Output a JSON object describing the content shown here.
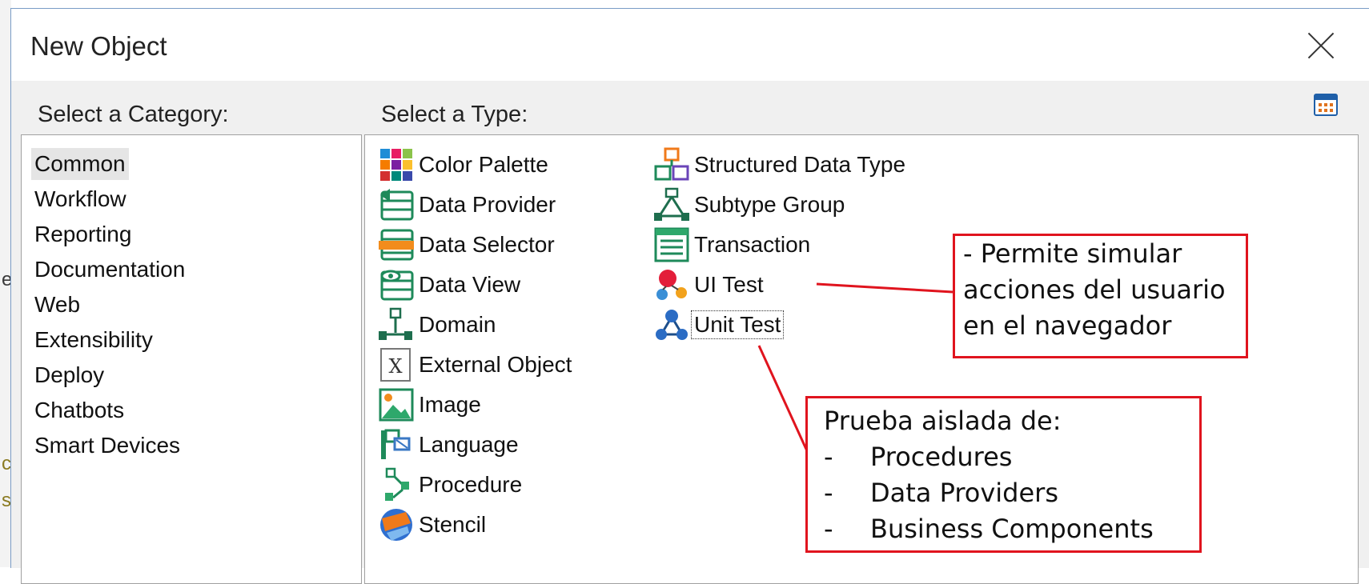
{
  "dialog": {
    "title": "New Object",
    "category_label": "Select a Category:",
    "type_label": "Select a Type:"
  },
  "categories": [
    {
      "label": "Common",
      "selected": true
    },
    {
      "label": "Workflow"
    },
    {
      "label": "Reporting"
    },
    {
      "label": "Documentation"
    },
    {
      "label": "Web"
    },
    {
      "label": "Extensibility"
    },
    {
      "label": "Deploy"
    },
    {
      "label": "Chatbots"
    },
    {
      "label": "Smart Devices"
    }
  ],
  "types_col1": [
    {
      "label": "Color Palette",
      "icon": "color-palette-icon"
    },
    {
      "label": "Data Provider",
      "icon": "data-provider-icon"
    },
    {
      "label": "Data Selector",
      "icon": "data-selector-icon"
    },
    {
      "label": "Data View",
      "icon": "data-view-icon"
    },
    {
      "label": "Domain",
      "icon": "domain-icon"
    },
    {
      "label": "External Object",
      "icon": "external-object-icon"
    },
    {
      "label": "Image",
      "icon": "image-icon"
    },
    {
      "label": "Language",
      "icon": "language-icon"
    },
    {
      "label": "Procedure",
      "icon": "procedure-icon"
    },
    {
      "label": "Stencil",
      "icon": "stencil-icon"
    }
  ],
  "types_col2": [
    {
      "label": "Structured Data Type",
      "icon": "structured-data-type-icon"
    },
    {
      "label": "Subtype Group",
      "icon": "subtype-group-icon"
    },
    {
      "label": "Transaction",
      "icon": "transaction-icon"
    },
    {
      "label": "UI Test",
      "icon": "ui-test-icon"
    },
    {
      "label": "Unit Test",
      "icon": "unit-test-icon",
      "focused": true
    }
  ],
  "external_object_glyph": "X",
  "background_glyphs": [
    "e",
    "c",
    "s"
  ],
  "callout_ui_test": [
    "- Permite simular",
    "acciones del usuario",
    "en el navegador"
  ],
  "callout_unit_test": {
    "heading": "Prueba aislada de:",
    "bullet": "-",
    "items": [
      "Procedures",
      "Data Providers",
      "Business Components"
    ]
  },
  "colors": {
    "callout_border": "#e0141e",
    "dialog_bg": "#f0f0f0",
    "accent_green": "#1e8a5a"
  }
}
